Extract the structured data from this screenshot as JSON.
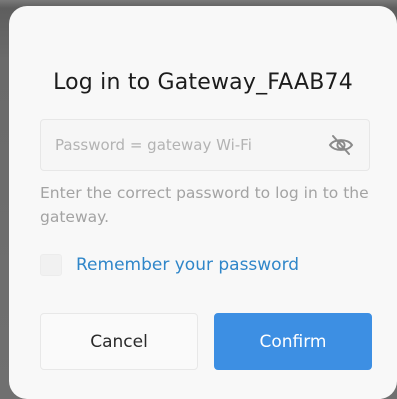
{
  "dialog": {
    "title": "Log in to Gateway_FAAB74",
    "password": {
      "value": "",
      "placeholder": "Password = gateway Wi-Fi",
      "visibility_icon": "eye-off-icon"
    },
    "hint": "Enter the correct password to log in to the gateway.",
    "remember": {
      "checked": false,
      "label": "Remember your password"
    },
    "buttons": {
      "cancel_label": "Cancel",
      "confirm_label": "Confirm"
    }
  },
  "colors": {
    "accent": "#3d8fe3",
    "link": "#2f86c9",
    "hint_text": "#a3a3a3",
    "dialog_bg": "#f8f8f8"
  }
}
